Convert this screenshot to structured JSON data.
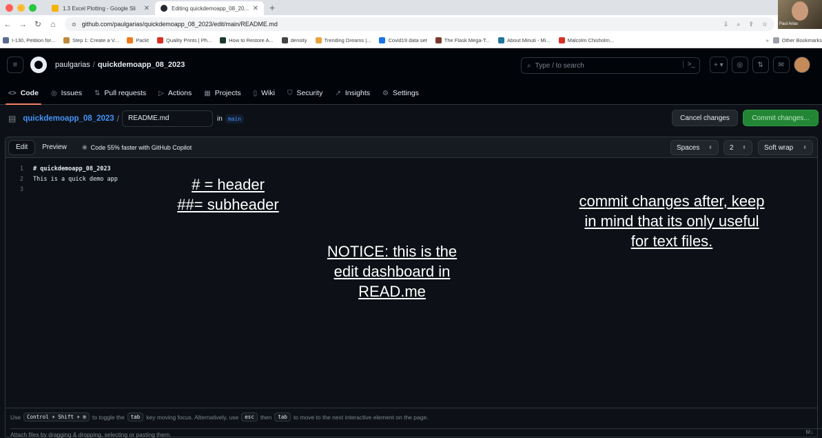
{
  "browser": {
    "tabs": [
      {
        "title": "1.3 Excel Plotting - Google Sli",
        "color": "#f4b400"
      },
      {
        "title": "Editing quickdemoapp_08_20...",
        "color": "#24292f"
      }
    ],
    "url": "github.com/paulgarias/quickdemoapp_08_2023/edit/main/README.md",
    "bookmarks": [
      {
        "label": "I-130, Petition for...",
        "color": "#5b6b8c"
      },
      {
        "label": "Step 1: Create a V...",
        "color": "#c08a3e"
      },
      {
        "label": "Packt",
        "color": "#ef7b1a"
      },
      {
        "label": "Quality Prints | Ph...",
        "color": "#d93025"
      },
      {
        "label": "How to Restore A...",
        "color": "#1d3b2a"
      },
      {
        "label": "density",
        "color": "#444444"
      },
      {
        "label": "Trending Dreams |...",
        "color": "#e8a33d"
      },
      {
        "label": "Covid19 data set",
        "color": "#1a73e8"
      },
      {
        "label": "The Flask Mega-T...",
        "color": "#7a3b2e"
      },
      {
        "label": "About Minuti - Mi...",
        "color": "#21759b"
      },
      {
        "label": "Malcolm Chisholm...",
        "color": "#d93025"
      }
    ],
    "bookmarks_more": "»",
    "other_bookmarks": "Other Bookmarks"
  },
  "github": {
    "owner": "paulgarias",
    "repo": "quickdemoapp_08_2023",
    "search_placeholder": "Type / to search",
    "nav": [
      {
        "label": "Code",
        "icon": "<>"
      },
      {
        "label": "Issues",
        "icon": "◎"
      },
      {
        "label": "Pull requests",
        "icon": "⇅"
      },
      {
        "label": "Actions",
        "icon": "▷"
      },
      {
        "label": "Projects",
        "icon": "▦"
      },
      {
        "label": "Wiki",
        "icon": "▯"
      },
      {
        "label": "Security",
        "icon": "⛉"
      },
      {
        "label": "Insights",
        "icon": "↗"
      },
      {
        "label": "Settings",
        "icon": "⚙"
      }
    ]
  },
  "editor": {
    "repo_link": "quickdemoapp_08_2023",
    "filename": "README.md",
    "in_label": "in",
    "branch": "main",
    "cancel_label": "Cancel changes",
    "commit_label": "Commit changes...",
    "tab_edit": "Edit",
    "tab_preview": "Preview",
    "copilot_text": "Code 55% faster with GitHub Copilot",
    "indent_mode": "Spaces",
    "indent_size": "2",
    "wrap_mode": "Soft wrap",
    "lines": [
      {
        "n": "1",
        "text": "# quickdemoapp_08_2023"
      },
      {
        "n": "2",
        "text": "This is a quick demo app"
      },
      {
        "n": "3",
        "text": ""
      }
    ]
  },
  "annotations": {
    "header_note": [
      "# = header",
      "##= subheader"
    ],
    "notice_note": [
      "NOTICE: this is the",
      "edit dashboard in",
      "READ.me"
    ],
    "commit_note": [
      "commit changes after, keep",
      "in mind that its only useful",
      "for text files."
    ]
  },
  "footer": {
    "use": "Use",
    "k1": "Control + Shift + m",
    "t1": "to toggle the",
    "k2": "tab",
    "t2": "key moving focus. Alternatively, use",
    "k3": "esc",
    "t3": "then",
    "k4": "tab",
    "t4": "to move to the next interactive element on the page.",
    "attach": "Attach files by dragging & dropping, selecting or pasting them."
  },
  "webcam_label": "Paul Arias"
}
